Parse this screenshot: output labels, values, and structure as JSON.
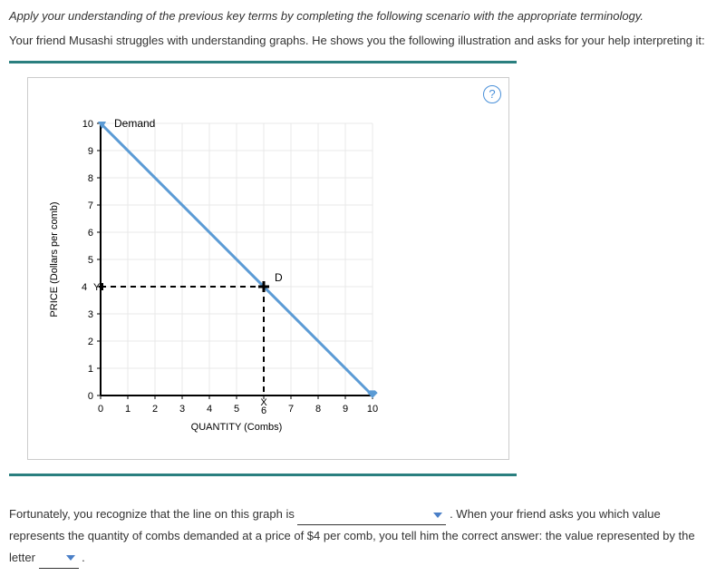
{
  "instructions": "Apply your understanding of the previous key terms by completing the following scenario with the appropriate terminology.",
  "scenario_intro": "Your friend Musashi struggles with understanding graphs. He shows you the following illustration and asks for your help interpreting it:",
  "help_icon_label": "?",
  "chart_data": {
    "type": "line",
    "xlabel": "QUANTITY (Combs)",
    "ylabel": "PRICE (Dollars per comb)",
    "xlim": [
      0,
      10
    ],
    "ylim": [
      0,
      10
    ],
    "x_ticks": [
      0,
      1,
      2,
      3,
      4,
      5,
      6,
      7,
      8,
      9,
      10
    ],
    "y_ticks": [
      0,
      1,
      2,
      3,
      4,
      5,
      6,
      7,
      8,
      9,
      10
    ],
    "series": [
      {
        "name": "Demand",
        "x": [
          0,
          10
        ],
        "y": [
          10,
          0
        ],
        "color": "#5b9bd5"
      }
    ],
    "annotations": {
      "legend_label": "Demand",
      "point_label_D": "D",
      "axis_marker_Y": "Y",
      "axis_marker_X": "X",
      "dashed_point": {
        "x": 6,
        "y": 4
      }
    }
  },
  "conclusion": {
    "part1": "Fortunately, you recognize that the line on this graph is ",
    "part2": " . When your friend asks you which value represents the quantity of combs demanded at a price of $4 per comb, you tell him the correct answer: the value represented by the letter ",
    "part3": " ."
  }
}
